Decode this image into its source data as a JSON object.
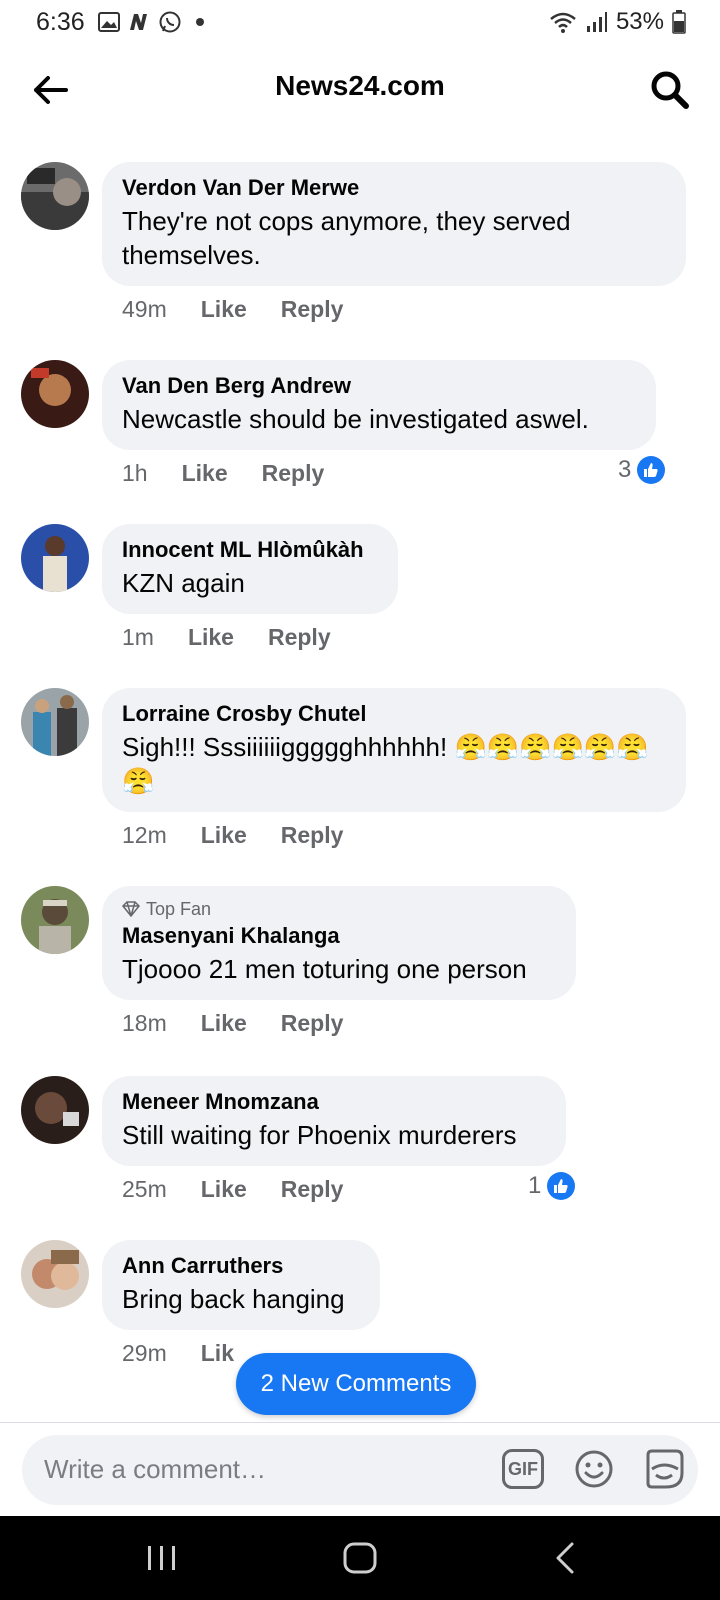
{
  "status_bar": {
    "time": "6:36",
    "battery": "53%"
  },
  "header": {
    "title": "News24.com"
  },
  "comments": [
    {
      "author": "Verdon Van Der Merwe",
      "text": "They're not cops anymore, they served themselves.",
      "time": "49m",
      "like": "Like",
      "reply": "Reply"
    },
    {
      "author": "Van Den Berg Andrew",
      "text": "Newcastle  should be investigated aswel.",
      "time": "1h",
      "like": "Like",
      "reply": "Reply",
      "reactions": "3"
    },
    {
      "author": "Innocent ML Hlòmûkàh",
      "text": "KZN again",
      "time": "1m",
      "like": "Like",
      "reply": "Reply"
    },
    {
      "author": "Lorraine Crosby Chutel",
      "text": "Sigh!!! Sssiiiiiiggggghhhhhh! 😤😤😤😤😤😤😤",
      "time": "12m",
      "like": "Like",
      "reply": "Reply"
    },
    {
      "badge": "Top Fan",
      "author": "Masenyani Khalanga",
      "text": "Tjoooo 21 men toturing one person",
      "time": "18m",
      "like": "Like",
      "reply": "Reply"
    },
    {
      "author": "Meneer Mnomzana",
      "text": "Still waiting for Phoenix murderers",
      "time": "25m",
      "like": "Like",
      "reply": "Reply",
      "reactions": "1"
    },
    {
      "author": "Ann Carruthers",
      "text": "Bring back hanging",
      "time": "29m",
      "like": "Lik"
    }
  ],
  "new_comments_pill": "2 New Comments",
  "composer": {
    "placeholder": "Write a comment…",
    "gif_label": "GIF"
  },
  "colors": {
    "accent": "#1877f2",
    "bubble": "#f0f2f5",
    "secondary_text": "#65676b"
  },
  "icons": {
    "back": "arrow-left-icon",
    "search": "search-icon",
    "emoji": "smiley-icon",
    "sticker": "sticker-icon"
  }
}
